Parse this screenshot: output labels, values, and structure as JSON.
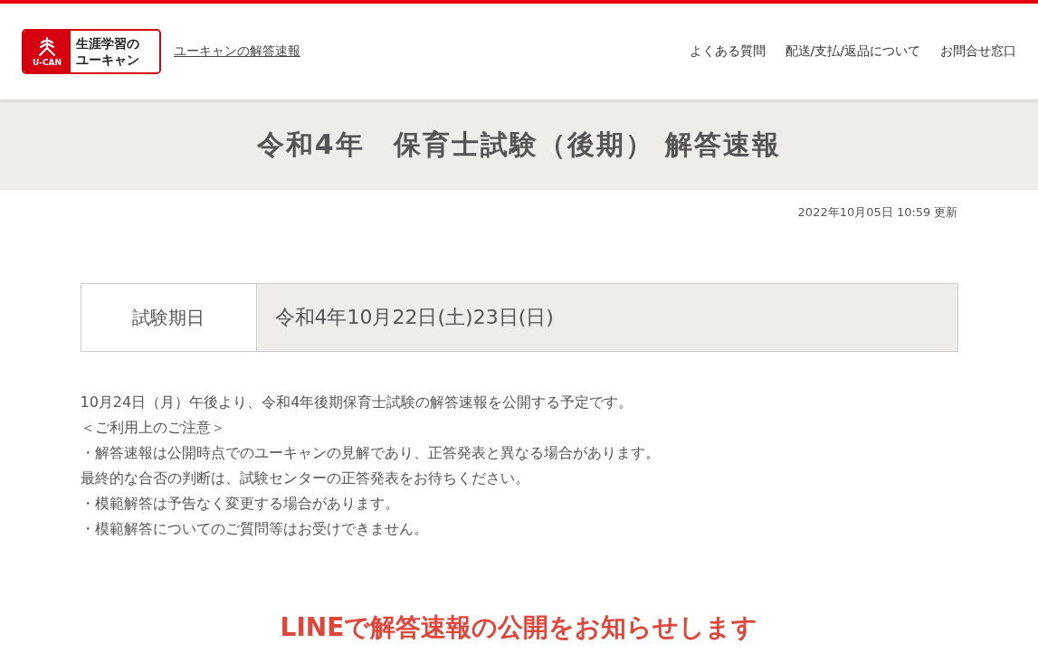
{
  "header": {
    "logo": {
      "mark_text": "U-CAN",
      "line_1": "生涯学習の",
      "line_2": "ユーキャン"
    },
    "site_link": "ユーキャンの解答速報",
    "nav": [
      "よくある質問",
      "配送/支払/返品について",
      "お問合せ窓口"
    ]
  },
  "title": "令和4年　保育士試験（後期） 解答速報",
  "updated": "2022年10月05日 10:59 更新",
  "exam_table": {
    "label": "試験期日",
    "value": "令和4年10月22日(土)23日(日)"
  },
  "notice_lines": [
    "10月24日（月）午後より、令和4年後期保育士試験の解答速報を公開する予定です。",
    "＜ご利用上のご注意＞",
    "・解答速報は公開時点でのユーキャンの見解であり、正答発表と異なる場合があります。",
    "最終的な合否の判断は、試験センターの正答発表をお待ちください。",
    "・模範解答は予告なく変更する場合があります。",
    "・模範解答についてのご質問等はお受けできません。"
  ],
  "line_heading": "LINEで解答速報の公開をお知らせします"
}
